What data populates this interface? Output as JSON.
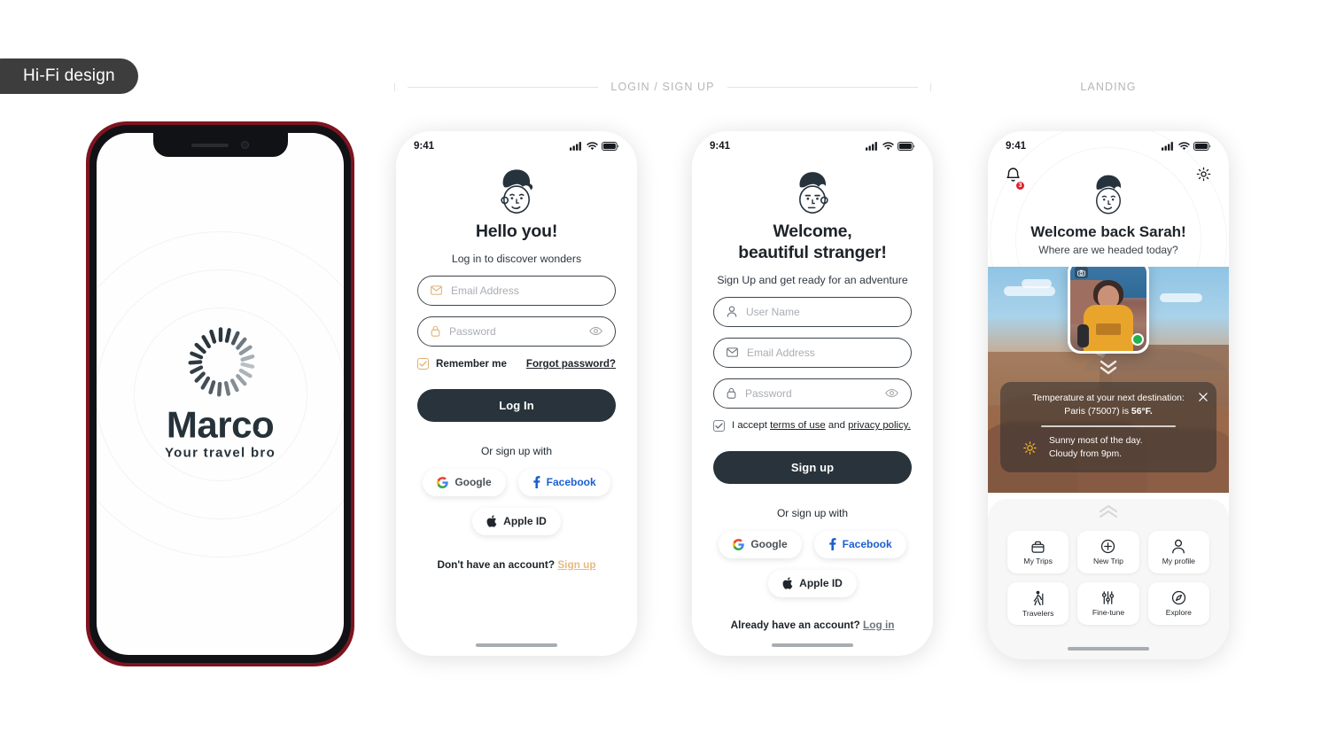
{
  "badge": {
    "label": "Hi-Fi design"
  },
  "sections": {
    "login_signup": "LOGIN / SIGN UP",
    "landing": "LANDING"
  },
  "brand": {
    "name": "Marco",
    "tagline": "Your travel bro",
    "logo_icon": "sunburst-icon"
  },
  "status_bar": {
    "time": "9:41",
    "icons": [
      "cellular-signal-icon",
      "wifi-icon",
      "battery-icon"
    ]
  },
  "login": {
    "mascot_icon": "face-mascot-icon",
    "title": "Hello you!",
    "subtitle": "Log in to discover wonders",
    "fields": [
      {
        "icon": "envelope-icon",
        "placeholder": "Email Address",
        "value": ""
      },
      {
        "icon": "lock-icon",
        "placeholder": "Password",
        "value": "",
        "trailing_icon": "eye-icon"
      }
    ],
    "remember_label": "Remember me",
    "remember_checked": true,
    "forgot_label": "Forgot password?",
    "submit_label": "Log In",
    "or_label": "Or sign up with",
    "socials": [
      {
        "name": "Google",
        "icon": "google-icon"
      },
      {
        "name": "Facebook",
        "icon": "facebook-icon"
      },
      {
        "name": "Apple ID",
        "icon": "apple-icon"
      }
    ],
    "foot_prefix": "Don't have an account?",
    "foot_link": "Sign up"
  },
  "signup": {
    "mascot_icon": "face-mascot-icon",
    "title_line1": "Welcome,",
    "title_line2": "beautiful stranger!",
    "subtitle": "Sign Up and get ready for an adventure",
    "fields": [
      {
        "icon": "person-icon",
        "placeholder": "User Name",
        "value": ""
      },
      {
        "icon": "envelope-icon",
        "placeholder": "Email Address",
        "value": ""
      },
      {
        "icon": "lock-icon",
        "placeholder": "Password",
        "value": "",
        "trailing_icon": "eye-icon"
      }
    ],
    "terms_prefix": "I accept",
    "terms_link1": "terms of use",
    "terms_mid": "and",
    "terms_link2": "privacy policy.",
    "terms_checked": true,
    "submit_label": "Sign up",
    "or_label": "Or sign up with",
    "socials": [
      {
        "name": "Google",
        "icon": "google-icon"
      },
      {
        "name": "Facebook",
        "icon": "facebook-icon"
      },
      {
        "name": "Apple ID",
        "icon": "apple-icon"
      }
    ],
    "foot_prefix": "Already have an account?",
    "foot_link": "Log in"
  },
  "landing": {
    "bell_icon": "bell-icon",
    "bell_badge": "3",
    "settings_icon": "gear-icon",
    "mascot_icon": "face-mascot-icon",
    "title": "Welcome back Sarah!",
    "subtitle": "Where are we headed today?",
    "profile": {
      "camera_icon": "camera-icon",
      "status": "online"
    },
    "weather": {
      "line1": "Temperature at your next destination:",
      "line2_prefix": "Paris (75007) is",
      "temperature": "56°F.",
      "icon": "sun-icon",
      "forecast_line1": "Sunny most of the day.",
      "forecast_line2": "Cloudy from 9pm.",
      "close_icon": "close-icon"
    },
    "tiles": [
      {
        "label": "My Trips",
        "icon": "suitcase-icon"
      },
      {
        "label": "New Trip",
        "icon": "plus-circle-icon"
      },
      {
        "label": "My profile",
        "icon": "person-icon"
      },
      {
        "label": "Travelers",
        "icon": "hiker-icon"
      },
      {
        "label": "Fine-tune",
        "icon": "sliders-icon"
      },
      {
        "label": "Explore",
        "icon": "compass-icon"
      }
    ]
  },
  "colors": {
    "dark": "#28333b",
    "accent_orange": "#e0b071",
    "phone_frame": "#7e1420",
    "online": "#21b24b",
    "badge_red": "#e0202e"
  }
}
